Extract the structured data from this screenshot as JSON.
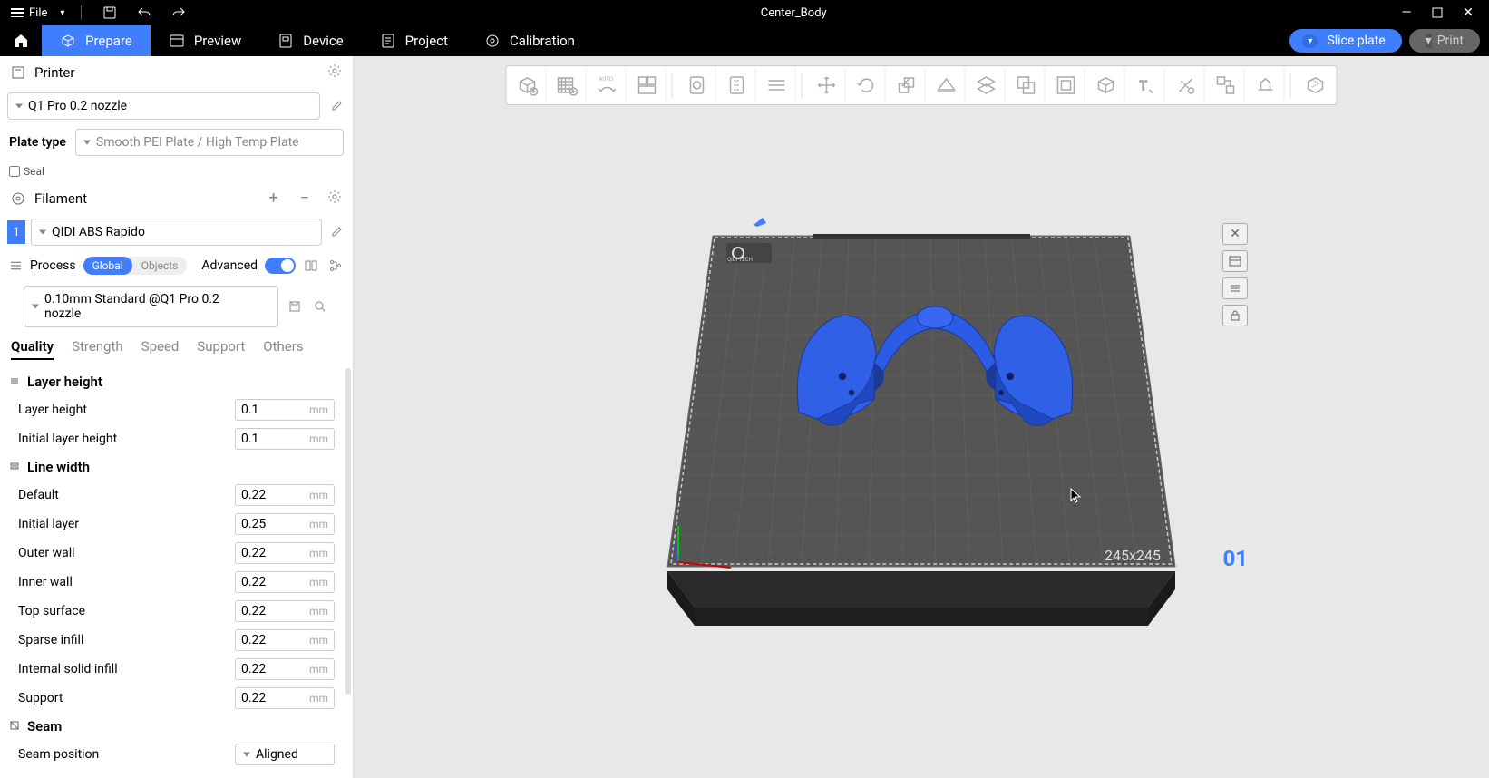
{
  "titlebar": {
    "fileLabel": "File",
    "title": "Center_Body"
  },
  "tabs": {
    "prepare": "Prepare",
    "preview": "Preview",
    "device": "Device",
    "project": "Project",
    "calibration": "Calibration"
  },
  "actions": {
    "slice": "Slice plate",
    "print": "Print"
  },
  "printer": {
    "header": "Printer",
    "selected": "Q1 Pro 0.2 nozzle",
    "plateTypeLabel": "Plate type",
    "plateType": "Smooth PEI Plate / High Temp Plate",
    "sealLabel": "Seal"
  },
  "filament": {
    "header": "Filament",
    "items": [
      {
        "num": "1",
        "name": "QIDI ABS Rapido"
      }
    ]
  },
  "process": {
    "header": "Process",
    "globalLabel": "Global",
    "objectsLabel": "Objects",
    "advancedLabel": "Advanced",
    "preset": "0.10mm Standard @Q1 Pro 0.2 nozzle"
  },
  "settingTabs": {
    "quality": "Quality",
    "strength": "Strength",
    "speed": "Speed",
    "support": "Support",
    "others": "Others"
  },
  "groups": {
    "layerHeight": {
      "title": "Layer height",
      "rows": [
        {
          "label": "Layer height",
          "value": "0.1",
          "unit": "mm"
        },
        {
          "label": "Initial layer height",
          "value": "0.1",
          "unit": "mm"
        }
      ]
    },
    "lineWidth": {
      "title": "Line width",
      "rows": [
        {
          "label": "Default",
          "value": "0.22",
          "unit": "mm"
        },
        {
          "label": "Initial layer",
          "value": "0.25",
          "unit": "mm"
        },
        {
          "label": "Outer wall",
          "value": "0.22",
          "unit": "mm"
        },
        {
          "label": "Inner wall",
          "value": "0.22",
          "unit": "mm"
        },
        {
          "label": "Top surface",
          "value": "0.22",
          "unit": "mm"
        },
        {
          "label": "Sparse infill",
          "value": "0.22",
          "unit": "mm"
        },
        {
          "label": "Internal solid infill",
          "value": "0.22",
          "unit": "mm"
        },
        {
          "label": "Support",
          "value": "0.22",
          "unit": "mm"
        }
      ]
    },
    "seam": {
      "title": "Seam",
      "position": {
        "label": "Seam position",
        "value": "Aligned"
      }
    }
  },
  "plate": {
    "size": "245x245",
    "number": "01"
  }
}
